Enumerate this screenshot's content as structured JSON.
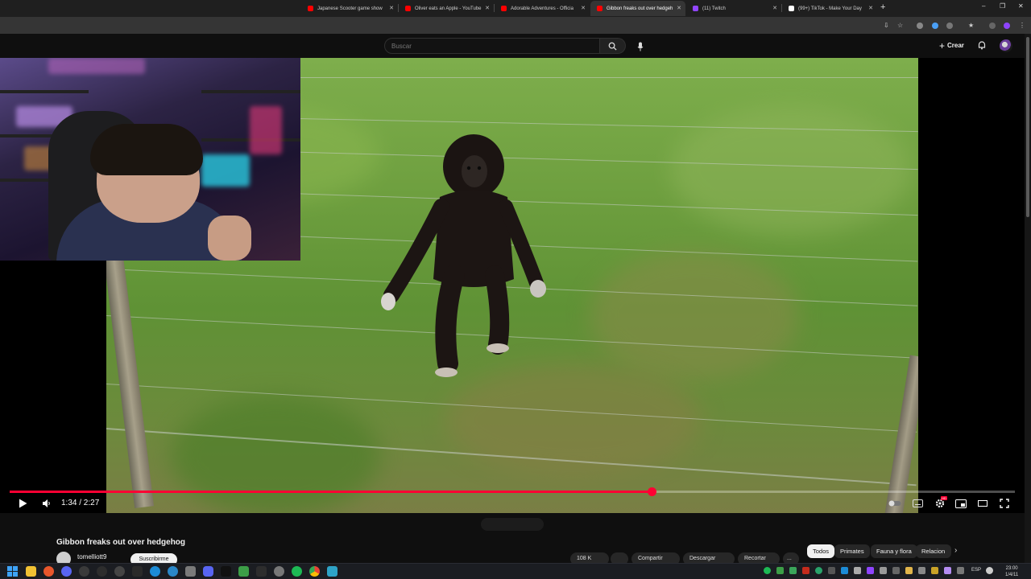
{
  "browser": {
    "tabs": [
      {
        "title": "Japanese Scooter game show",
        "favicon_color": "#ff0000",
        "active": false
      },
      {
        "title": "Oliver eats an Apple - YouTube",
        "favicon_color": "#ff0000",
        "active": false
      },
      {
        "title": "Adorable Adventures - Officia",
        "favicon_color": "#ff0000",
        "active": false
      },
      {
        "title": "Gibbon freaks out over hedgeh",
        "favicon_color": "#ff0000",
        "active": true
      },
      {
        "title": "(11) Twitch",
        "favicon_color": "#9146ff",
        "active": false
      },
      {
        "title": "(99+) TikTok - Make Your Day",
        "favicon_color": "#ffffff",
        "active": false
      }
    ],
    "new_tab_label": "+",
    "window_controls": [
      "–",
      "❐",
      "✕"
    ]
  },
  "youtube_header": {
    "search_placeholder": "Buscar",
    "create_label": "Crear"
  },
  "player": {
    "current_time": "1:34",
    "duration": "2:27",
    "time_display": "1:34 / 2:27",
    "progress_fraction": 0.639,
    "hd_badge": "HD",
    "accent_color": "#ff0033"
  },
  "video_info": {
    "title": "Gibbon freaks out over hedgehog",
    "channel": "tomelliott9",
    "subscribe_label": "Suscribirme",
    "actions": [
      {
        "label": "108 K"
      },
      {
        "label": ""
      },
      {
        "label": "Compartir"
      },
      {
        "label": "Descargar"
      },
      {
        "label": "Recortar"
      },
      {
        "label": "..."
      }
    ]
  },
  "related_chips": [
    {
      "label": "Todos",
      "active": true
    },
    {
      "label": "Primates",
      "active": false
    },
    {
      "label": "Fauna y flora",
      "active": false
    },
    {
      "label": "Relacion",
      "active": false
    }
  ],
  "taskbar": {
    "language": "ESP",
    "time": "23:00",
    "date": "1/4/11"
  }
}
